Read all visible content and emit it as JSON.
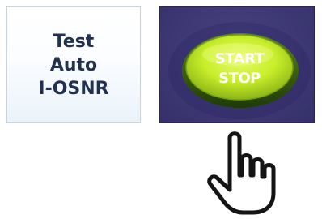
{
  "test_auto_button": {
    "lines": [
      "Test",
      "Auto",
      "I-OSNR"
    ]
  },
  "start_stop_button": {
    "line1": "START",
    "line2": "STOP",
    "color": "#c8ee2a",
    "panel_color": "#403b76"
  },
  "cursor": {
    "icon": "hand-pointer-icon"
  }
}
